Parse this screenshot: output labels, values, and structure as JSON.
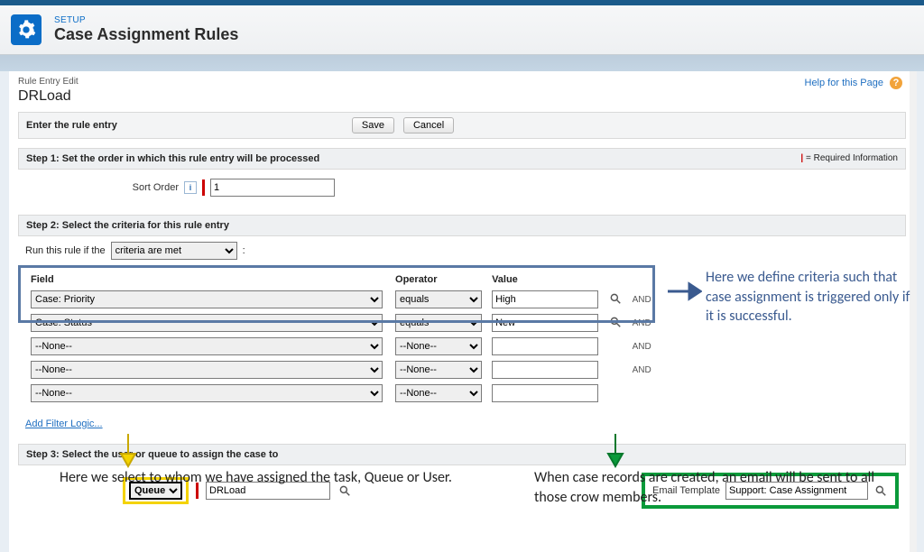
{
  "header": {
    "eyebrow": "SETUP",
    "title": "Case Assignment Rules"
  },
  "help": {
    "label": "Help for this Page"
  },
  "crumb": "Rule Entry Edit",
  "rule_name": "DRLoad",
  "section_enter": {
    "title": "Enter the rule entry",
    "save": "Save",
    "cancel": "Cancel"
  },
  "step1": {
    "title": "Step 1: Set the order in which this rule entry will be processed",
    "required_note": "= Required Information",
    "sort_label": "Sort Order",
    "sort_value": "1"
  },
  "step2": {
    "title": "Step 2: Select the criteria for this rule entry",
    "run_label": "Run this rule if the",
    "run_select": "criteria are met",
    "col_field": "Field",
    "col_operator": "Operator",
    "col_value": "Value",
    "and": "AND",
    "rows": [
      {
        "field": "Case: Priority",
        "op": "equals",
        "val": "High"
      },
      {
        "field": "Case: Status",
        "op": "equals",
        "val": "New"
      },
      {
        "field": "--None--",
        "op": "--None--",
        "val": ""
      },
      {
        "field": "--None--",
        "op": "--None--",
        "val": ""
      },
      {
        "field": "--None--",
        "op": "--None--",
        "val": ""
      }
    ],
    "add_filter": "Add Filter Logic..."
  },
  "step3": {
    "title": "Step 3: Select the user or queue to assign the case to",
    "assignee_type": "Queue",
    "assignee_value": "DRLoad",
    "email_label": "Email Template",
    "email_value": "Support: Case Assignment"
  },
  "annotations": {
    "criteria": "Here we define criteria such that case assignment is triggered only if it is successful.",
    "queue": "Here we select to whom we have assigned the task, Queue or User.",
    "email": "When case records are created, an email will be sent to all those crow members."
  },
  "colors": {
    "criteria_box": "#5a79a5",
    "queue_box": "#f4d300",
    "email_box": "#0a9a3a",
    "criteria_text": "#3a5a8f"
  }
}
